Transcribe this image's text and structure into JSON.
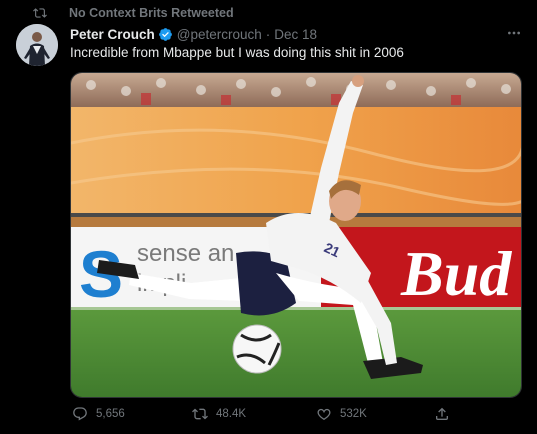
{
  "retweet": {
    "text": "No Context Brits Retweeted",
    "icon": "retweet-icon"
  },
  "author": {
    "name": "Peter Crouch",
    "handle": "@petercrouch",
    "date": "Dec 18",
    "verified": true
  },
  "tweet": {
    "text": "Incredible from Mbappe but I was doing this shit in 2006"
  },
  "media": {
    "description_icon": "photo",
    "ad_board_left_text": "sense an",
    "ad_board_left_text2": "impli",
    "ad_board_right_text": "Bud",
    "shirt_number": "21"
  },
  "actions": {
    "replies": "5,656",
    "retweets": "48.4K",
    "likes": "532K"
  },
  "colors": {
    "text": "#e7e9ea",
    "muted": "#71767b",
    "verified": "#1d9bf0",
    "background": "#000000"
  }
}
